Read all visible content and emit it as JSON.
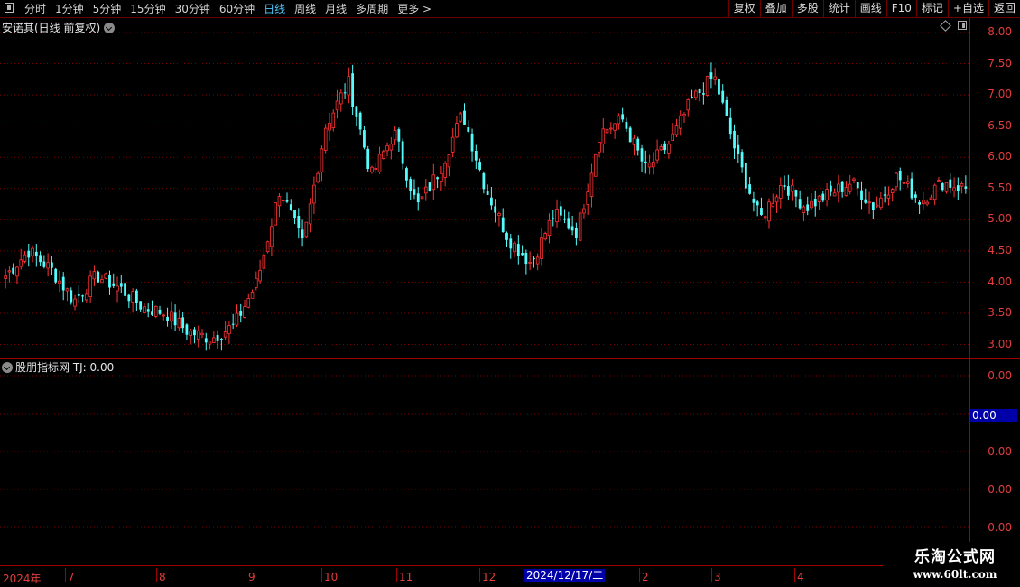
{
  "toolbar": {
    "period_tabs": [
      "分时",
      "1分钟",
      "5分钟",
      "15分钟",
      "30分钟",
      "60分钟",
      "日线",
      "周线",
      "月线",
      "多周期",
      "更多 >"
    ],
    "active_tab": "日线",
    "right_tools": [
      "复权",
      "叠加",
      "多股",
      "统计",
      "画线",
      "F10",
      "标记",
      "+自选",
      "返回"
    ]
  },
  "main_panel": {
    "title": "安诺其(日线 前复权)",
    "price_ticks": [
      "8.00",
      "7.50",
      "7.00",
      "6.50",
      "6.00",
      "5.50",
      "5.00",
      "4.50",
      "4.00",
      "3.50",
      "3.00"
    ]
  },
  "indicator_panel": {
    "title": "股朋指标网  TJ: 0.00",
    "ticks": [
      "0.00",
      "0.00",
      "0.00",
      "0.00",
      "0.00"
    ],
    "current_value": "0.00"
  },
  "date_axis": {
    "labels": [
      "2024年",
      "7",
      "8",
      "9",
      "10",
      "11",
      "12",
      "2",
      "3",
      "4"
    ],
    "cursor_date": "2024/12/17/二"
  },
  "watermark": {
    "title": "乐淘公式网",
    "url": "www.60lt.com"
  },
  "colors": {
    "up": "#ff3232",
    "down": "#54fcfc",
    "axis": "#a00000",
    "grid": "#7a0000",
    "tick_text": "#e23c3c",
    "active_tab": "#4fc3f7"
  },
  "chart_data": {
    "type": "candlestick",
    "series_approx_close": [
      4.1,
      4.5,
      4.2,
      3.7,
      4.1,
      3.9,
      3.6,
      3.5,
      3.2,
      3.1,
      3.3,
      4.0,
      5.5,
      4.6,
      6.5,
      7.2,
      5.7,
      6.4,
      5.2,
      5.8,
      6.7,
      5.5,
      4.7,
      4.3,
      5.1,
      4.8,
      6.4,
      6.6,
      5.8,
      6.2,
      6.9,
      7.3,
      6.0,
      5.0,
      5.6,
      5.2,
      5.4,
      5.6,
      5.2,
      5.7,
      5.3,
      5.6,
      5.5
    ],
    "ylim": [
      2.9,
      8.1
    ]
  }
}
